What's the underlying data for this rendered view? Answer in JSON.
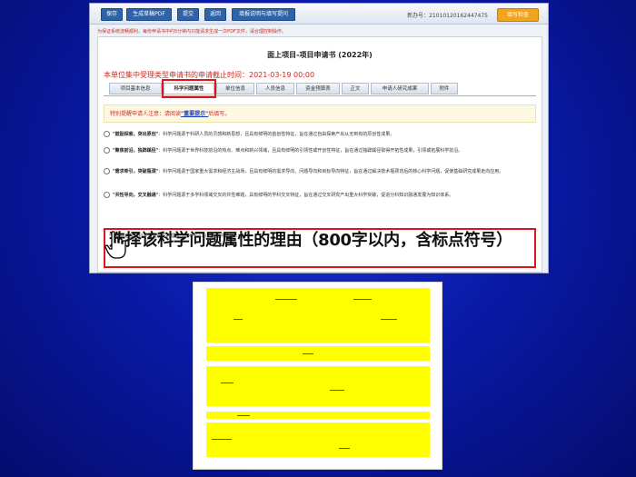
{
  "toolbar": {
    "buttons": [
      "保存",
      "生成草稿PDF",
      "提交",
      "返回",
      "填报说明与填写提问"
    ],
    "serial": "新办号：21010120162447475",
    "check_button": "填写检查"
  },
  "notice": "为保证系统流畅顺利，每份申请书中约5分钟内只能请求生成一次PDF文件，请合理控制操作。",
  "document": {
    "title": "面上项目-项目申请书 (2022年)",
    "deadline": "本单位集中受理类型申请书的申请截止时间：2021-03-19 00:00",
    "tabs": [
      "项目基本信息",
      "科学问题属性",
      "单位信息",
      "人员信息",
      "资金预算表",
      "正文",
      "申请人研究成果",
      "附件"
    ],
    "active_tab": "科学问题属性",
    "tip_prefix": "特别提醒申请人注意：请阅读",
    "tip_link": "\"重要提示\"",
    "tip_suffix": "后填写。",
    "options": [
      {
        "name": "\"鼓励探索，突出原创\"",
        "text": "：科学问题源于科研人员的灵感和新思想，且具有鲜明的首创性特征，旨在通过自由探索产出从无到有的原创性成果。"
      },
      {
        "name": "\"聚焦前沿，独辟蹊径\"",
        "text": "：科学问题源于世界科技前沿的热点、难点和新兴领域，且具有鲜明的引领性或开创性特征，旨在通过独辟蹊径取得开拓性成果，引领或拓展科学前沿。"
      },
      {
        "name": "\"需求牵引，突破瓶颈\"",
        "text": "：科学问题源于国家重大需求和经济主战场，且具有鲜明的需求导向、问题导向和目标导向特征，旨在通过解决技术瓶颈背后的核心科学问题，促使基础研究成果走向应用。"
      },
      {
        "name": "\"共性导向，交叉融通\"",
        "text": "：科学问题源于多学科领域交叉的共性难题，具有鲜明的学科交叉特征，旨在通过交叉研究产出重大科学突破，促进分科知识融通发展为知识体系。"
      }
    ],
    "reason_label": "*请阐明选择该科学问题属性的理由（800字以内，含标点符号）：",
    "reason_overlay": "选择该科学问题属性的理由（800字以内，含标点符号）"
  }
}
